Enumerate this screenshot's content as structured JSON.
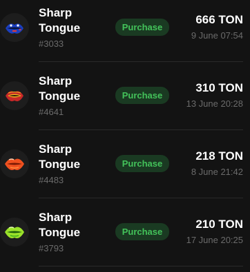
{
  "items": [
    {
      "name_line1": "Sharp",
      "name_line2": "Tongue",
      "number": "#3033",
      "action": "Purchase",
      "price": "666 TON",
      "date": "9 June 07:54",
      "icon": "lips-blue-flag-icon",
      "colors": {
        "lip": "#1b3fbf",
        "accent": "#e53935",
        "highlight": "#ffffff"
      }
    },
    {
      "name_line1": "Sharp",
      "name_line2": "Tongue",
      "number": "#4641",
      "action": "Purchase",
      "price": "310 TON",
      "date": "13 June 20:28",
      "icon": "lips-red-gold-icon",
      "colors": {
        "lip": "#c62828",
        "accent": "#f2b01e",
        "highlight": "#2a1a0a"
      }
    },
    {
      "name_line1": "Sharp",
      "name_line2": "Tongue",
      "number": "#4483",
      "action": "Purchase",
      "price": "218 TON",
      "date": "8 June 21:42",
      "icon": "lips-orange-icon",
      "colors": {
        "lip": "#f0511f",
        "accent": "#ff8a3d",
        "highlight": "#ffd1b0"
      }
    },
    {
      "name_line1": "Sharp",
      "name_line2": "Tongue",
      "number": "#3793",
      "action": "Purchase",
      "price": "210 TON",
      "date": "17 June 20:25",
      "icon": "lips-green-icon",
      "colors": {
        "lip": "#9be22a",
        "accent": "#3fae1a",
        "highlight": "#1e5d0c"
      }
    }
  ]
}
